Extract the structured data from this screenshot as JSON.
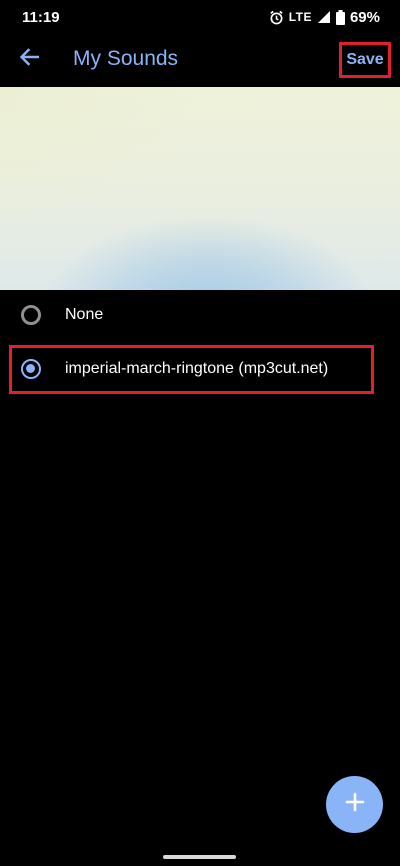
{
  "status_bar": {
    "time": "11:19",
    "network": "LTE",
    "battery_percent": "69%",
    "icons": [
      "alarm-icon",
      "signal-icon",
      "battery-icon"
    ]
  },
  "toolbar": {
    "title": "My Sounds",
    "save_label": "Save",
    "back_icon": "arrow-left-icon"
  },
  "sounds": {
    "options": [
      {
        "label": "None",
        "selected": false
      },
      {
        "label": "imperial-march-ringtone (mp3cut.net)",
        "selected": true
      }
    ]
  },
  "fab": {
    "icon": "plus-icon"
  },
  "colors": {
    "accent": "#8ab4f8",
    "highlight_box": "#e0202e",
    "background": "#000000"
  }
}
